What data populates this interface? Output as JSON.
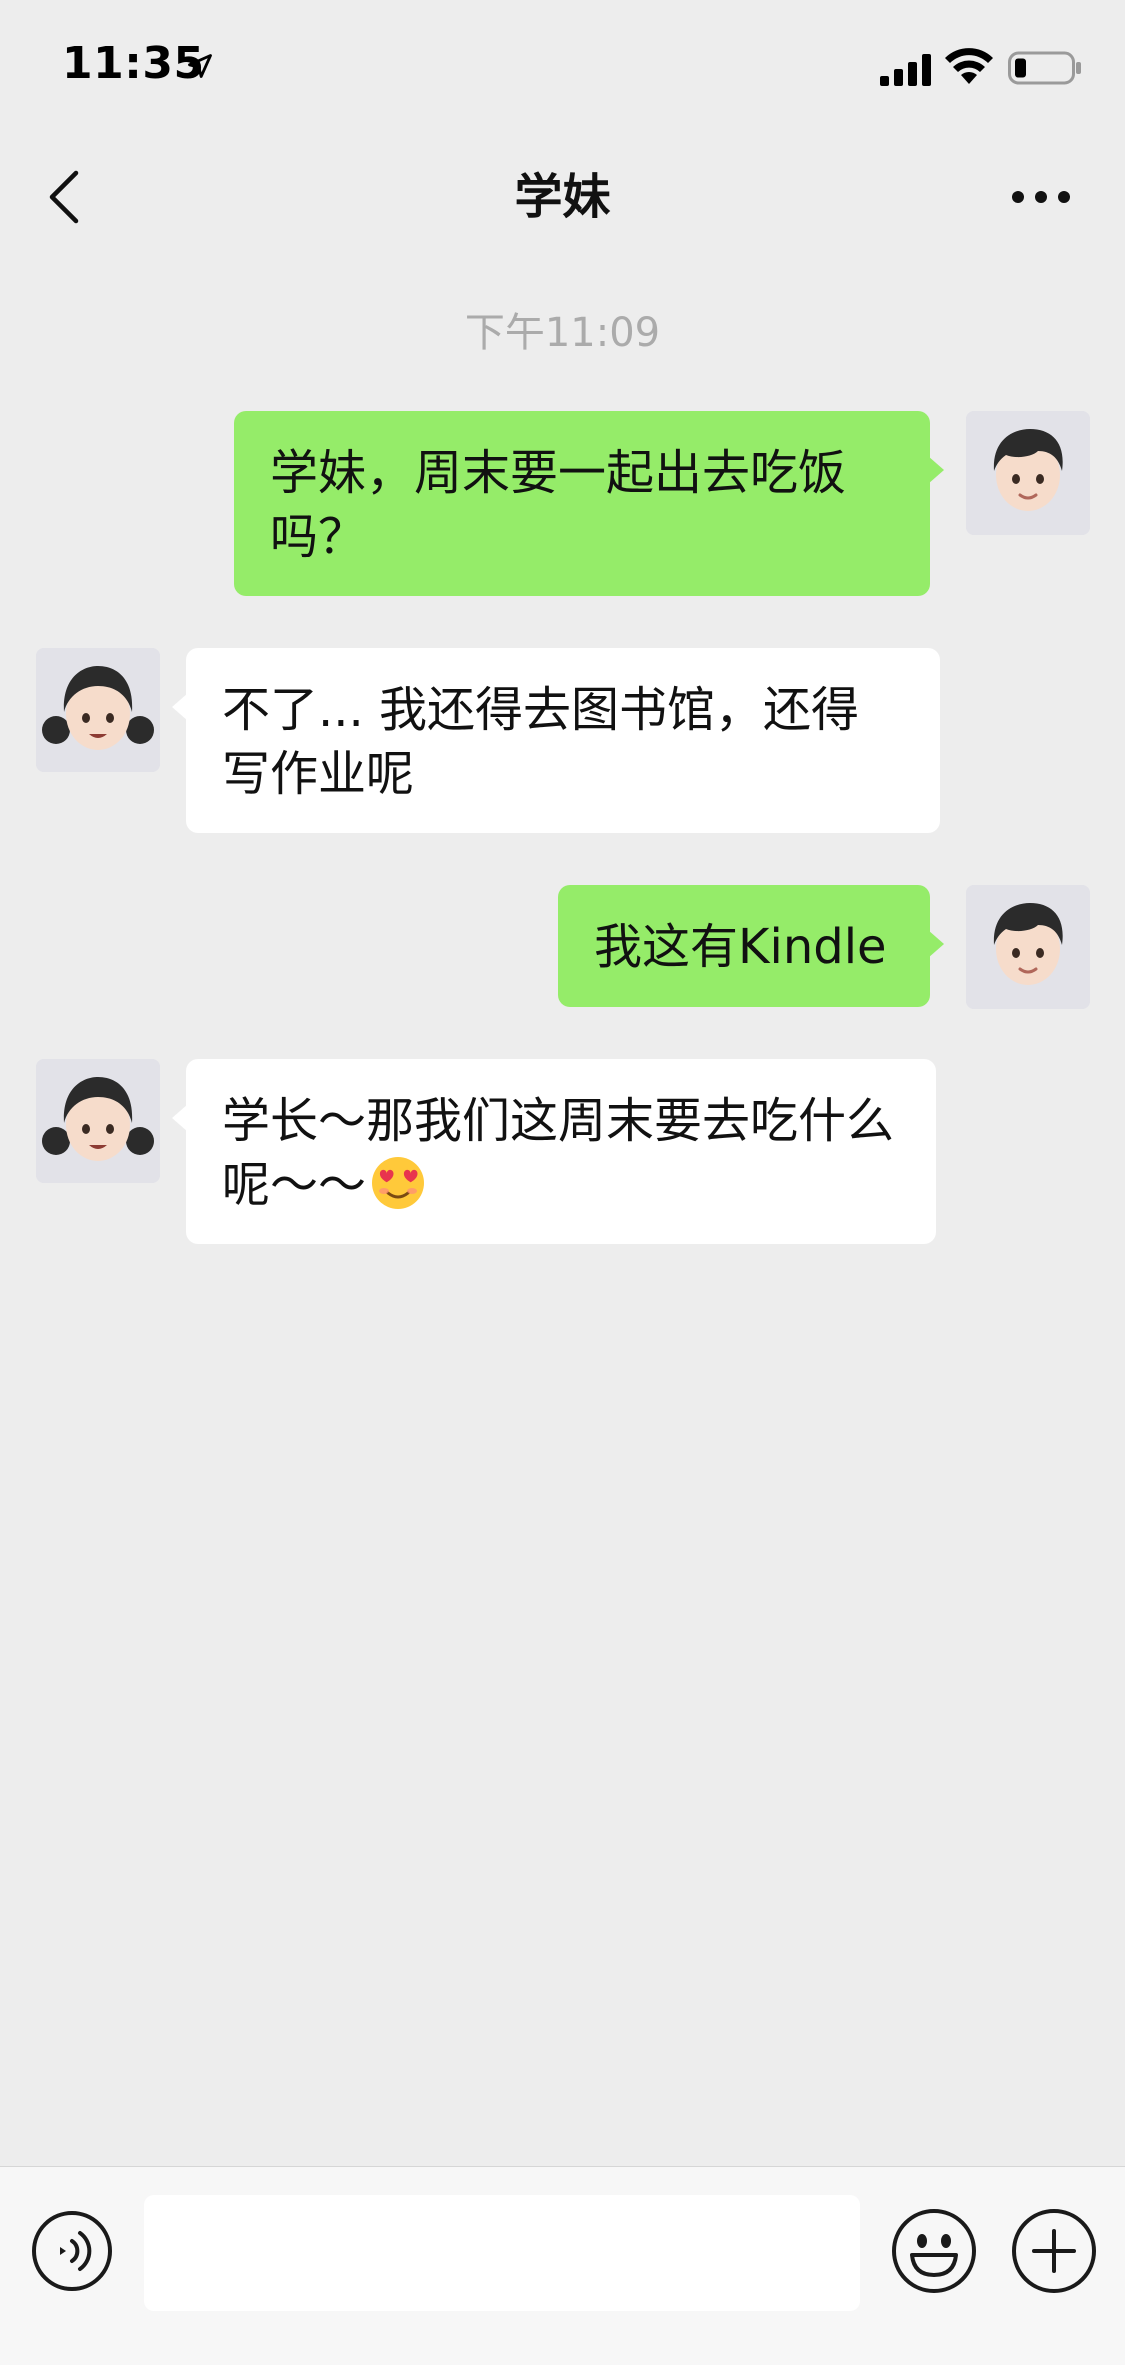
{
  "status_bar": {
    "time": "11:35",
    "location_icon": "location-arrow-icon",
    "signal_icon": "cellular-signal-icon",
    "wifi_icon": "wifi-icon",
    "battery_icon": "battery-low-icon"
  },
  "nav": {
    "title": "学妹",
    "back_icon": "chevron-left-icon",
    "more_icon": "more-dots-icon"
  },
  "chat": {
    "timestamp": "下午11:09",
    "messages": [
      {
        "sender": "me",
        "text": "学妹，周末要一起出去吃饭吗？",
        "avatar": "boy-avatar"
      },
      {
        "sender": "them",
        "text": "不了... 我还得去图书馆，还得写作业呢",
        "avatar": "girl-avatar"
      },
      {
        "sender": "me",
        "text": "我这有Kindle",
        "avatar": "boy-avatar"
      },
      {
        "sender": "them",
        "text": "学长～那我们这周末要去吃什么呢～～",
        "emoji": "heart-eyes-emoji",
        "avatar": "girl-avatar"
      }
    ]
  },
  "input_bar": {
    "value": "",
    "voice_icon": "voice-input-icon",
    "emoji_icon": "emoji-smile-icon",
    "plus_icon": "plus-circle-icon"
  },
  "colors": {
    "background": "#ededed",
    "my_bubble": "#95ec69",
    "their_bubble": "#ffffff",
    "timestamp_text": "#ababab",
    "input_bar": "#f7f7f7"
  }
}
